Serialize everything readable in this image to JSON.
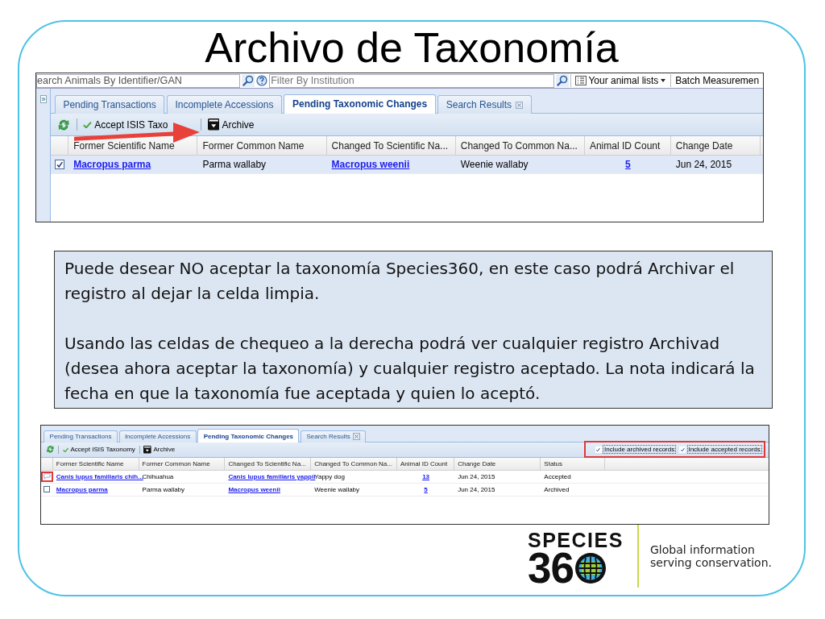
{
  "title": "Archivo de Taxonomía",
  "screenshot_1": {
    "search_bar": {
      "search_value": "earch Animals By Identifier/GAN",
      "filter_placeholder": "Filter By Institution",
      "menu_label": "Your animal lists",
      "batch_label": "Batch Measuremen"
    },
    "side_panel_collapsed": true,
    "tabs": [
      {
        "label": "Pending Transactions",
        "selected": false,
        "closable": false
      },
      {
        "label": "Incomplete Accessions",
        "selected": false,
        "closable": false
      },
      {
        "label": "Pending Taxonomic Changes",
        "selected": true,
        "closable": false
      },
      {
        "label": "Search Results",
        "selected": false,
        "closable": true
      }
    ],
    "toolbar": {
      "accept_label": "Accept ISIS Taxo",
      "archive_label": "Archive"
    },
    "columns": [
      {
        "label": "Former Scientific Name",
        "kind": "link"
      },
      {
        "label": "Former Common Name",
        "kind": "text"
      },
      {
        "label": "Changed To Scientific Na...",
        "kind": "link"
      },
      {
        "label": "Changed To Common Na...",
        "kind": "text"
      },
      {
        "label": "Animal ID Count",
        "kind": "count"
      },
      {
        "label": "Change Date",
        "kind": "text"
      }
    ],
    "rows": [
      {
        "kind": "checkbox",
        "checked": true,
        "selected": true,
        "cells": [
          "Macropus parma",
          "Parma wallaby",
          "Macropus weenii",
          "Weenie wallaby",
          "5",
          "Jun 24, 2015"
        ]
      }
    ]
  },
  "callout": [
    "Puede desear NO aceptar la taxonomía Species360, en este caso podrá Archivar el registro al dejar la celda limpia.",
    "Usando las celdas de chequeo a la derecha podrá ver cualquier registro Archivad (desea ahora aceptar la taxonomía) y cualquier registro aceptado. La nota indicará la fecha en que la taxonomía fue aceptada y quien lo aceptó."
  ],
  "screenshot_2": {
    "side_panel_collapsed": false,
    "tabs": [
      {
        "label": "Pending Transactions",
        "selected": false,
        "closable": false
      },
      {
        "label": "Incomplete Accessions",
        "selected": false,
        "closable": false
      },
      {
        "label": "Pending Taxonomic Changes",
        "selected": true,
        "closable": false
      },
      {
        "label": "Search Results",
        "selected": false,
        "closable": true
      }
    ],
    "toolbar": {
      "accept_label": "Accept ISIS Taxonomy",
      "archive_label": "Archive"
    },
    "options": [
      {
        "label": "Include archived records",
        "checked": true
      },
      {
        "label": "Include accepted records",
        "checked": true
      }
    ],
    "columns": [
      {
        "label": "Former Scientific Name",
        "kind": "link"
      },
      {
        "label": "Former Common Name",
        "kind": "text"
      },
      {
        "label": "Changed To Scientific Na...",
        "kind": "link"
      },
      {
        "label": "Changed To Common Na...",
        "kind": "text"
      },
      {
        "label": "Animal ID Count",
        "kind": "count"
      },
      {
        "label": "Change Date",
        "kind": "text"
      },
      {
        "label": "Status",
        "kind": "text"
      }
    ],
    "rows": [
      {
        "kind": "note",
        "selected": false,
        "cells": [
          "Canis lupus familiaris chih...",
          "Chihuahua",
          "Canis lupus familiaris yappii",
          "Yappy dog",
          "13",
          "Jun 24, 2015",
          "Accepted"
        ]
      },
      {
        "kind": "checkbox",
        "checked": false,
        "selected": false,
        "cells": [
          "Macropus parma",
          "Parma wallaby",
          "Macropus weenii",
          "Weenie wallaby",
          "5",
          "Jun 24, 2015",
          "Archived"
        ]
      }
    ]
  },
  "logo": {
    "wordmark": "SPECIES",
    "number": "36",
    "tagline": [
      "Global information",
      "serving conservation."
    ]
  }
}
